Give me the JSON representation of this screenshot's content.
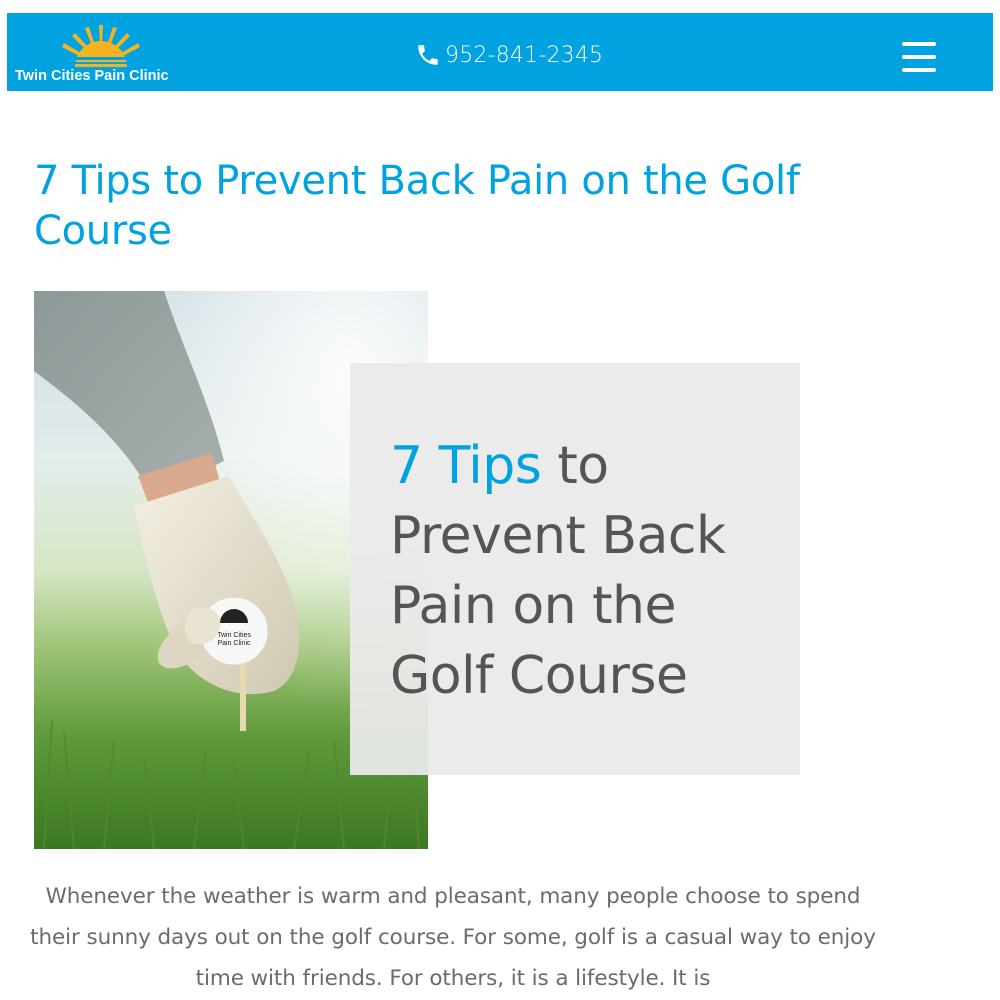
{
  "header": {
    "logo_text": "Twin Cities Pain Clinic",
    "phone": "952-841-2345",
    "background_color": "#00a3e0",
    "logo_sun_color": "#f5b320",
    "phone_icon": "phone-icon",
    "menu_icon": "hamburger-menu-icon"
  },
  "article": {
    "title": "7 Tips to Prevent Back Pain on the Golf Course",
    "title_color": "#00a3e0",
    "featured_image": {
      "headline_accent": "7 Tips",
      "headline_rest": " to Prevent Back Pain on the Golf Course",
      "ball_text": "Twin Cities Pain Clinic"
    },
    "intro": "Whenever the weather is warm and pleasant, many people choose to spend their sunny days out on the golf course. For some, golf is a casual way to enjoy time with friends. For others, it is a lifestyle. It is"
  }
}
